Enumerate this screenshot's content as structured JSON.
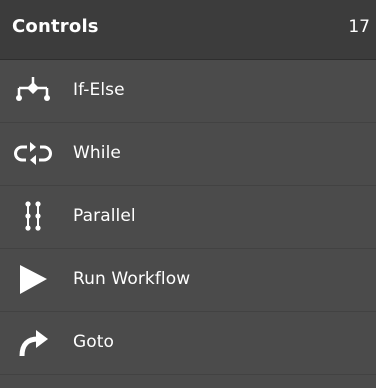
{
  "header": {
    "title": "Controls",
    "count": "17"
  },
  "items": [
    {
      "label": "If-Else",
      "icon": "branch-icon"
    },
    {
      "label": "While",
      "icon": "loop-icon"
    },
    {
      "label": "Parallel",
      "icon": "parallel-icon"
    },
    {
      "label": "Run Workflow",
      "icon": "play-icon"
    },
    {
      "label": "Goto",
      "icon": "redirect-arrow-icon"
    }
  ],
  "colors": {
    "panel_background": "#4b4b4b",
    "header_background": "#3c3c3c",
    "text": "#ffffff"
  }
}
